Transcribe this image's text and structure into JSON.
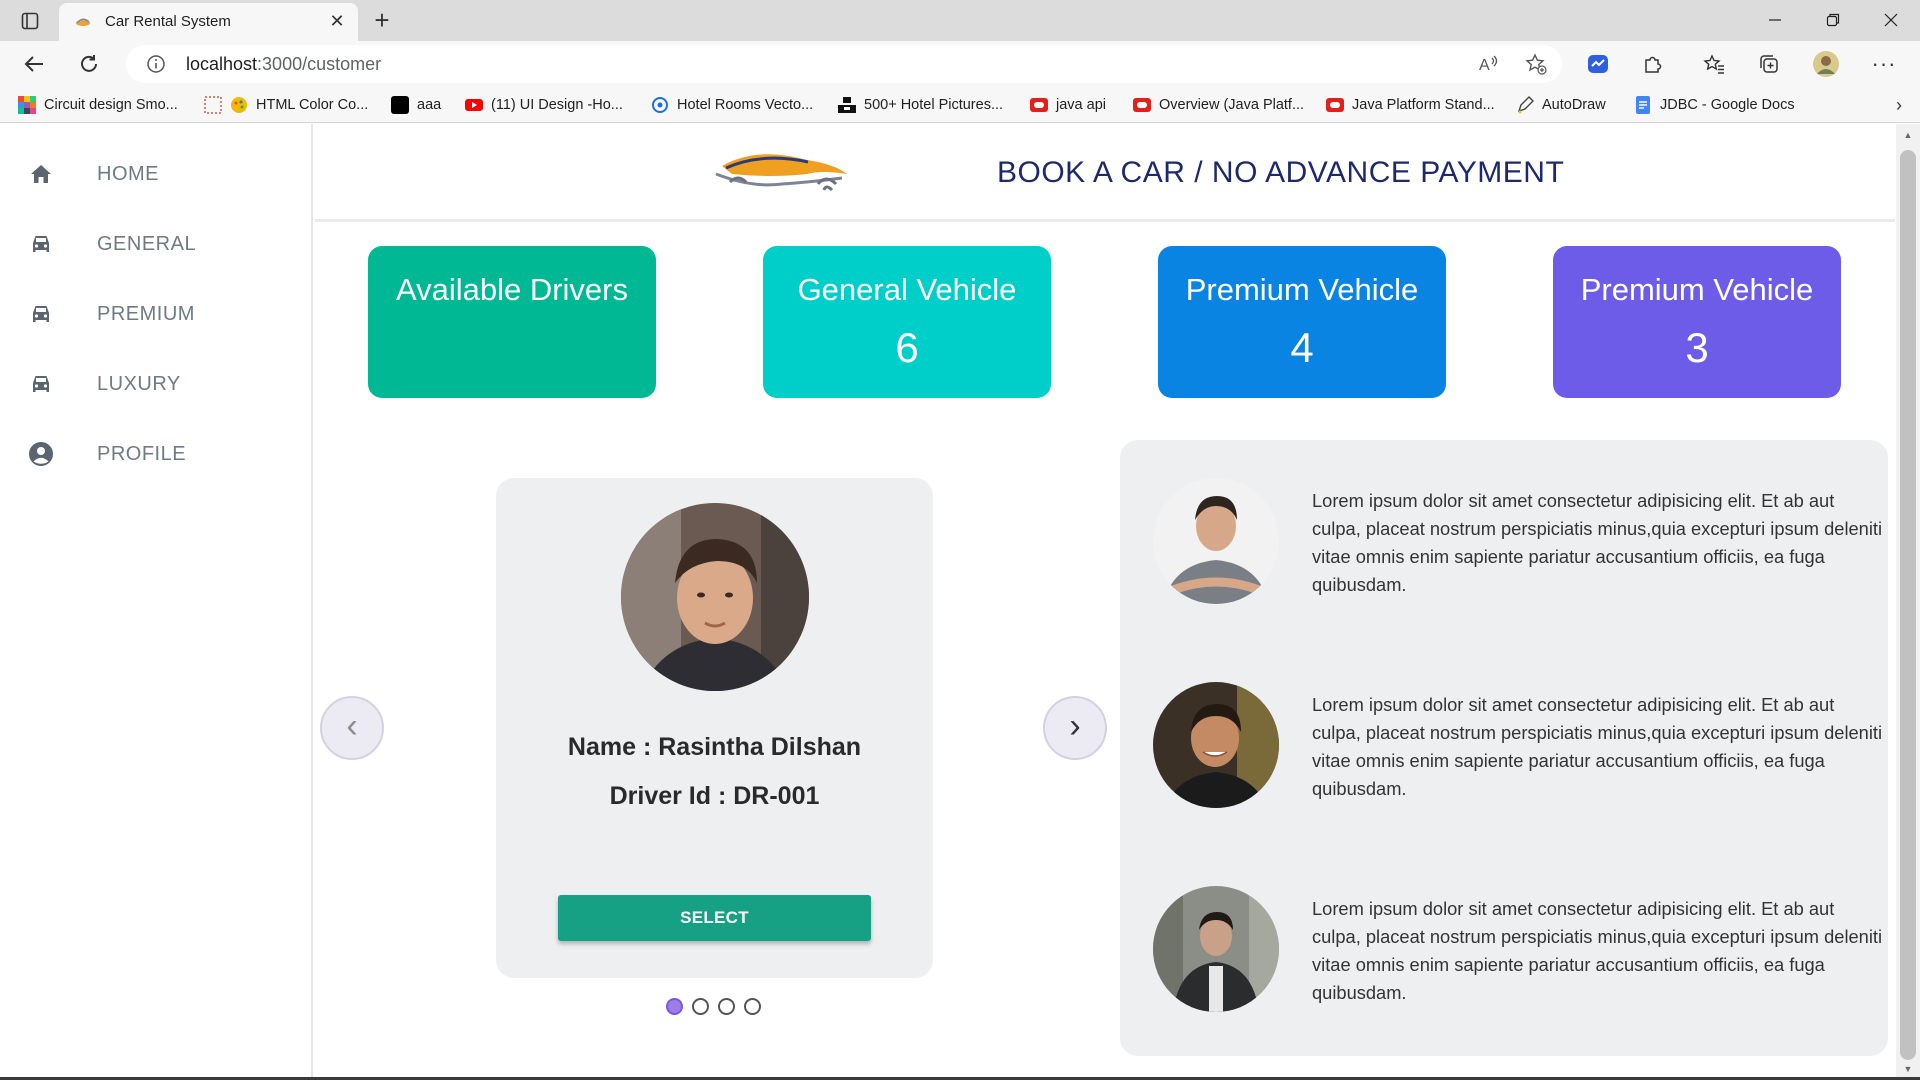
{
  "browser": {
    "tab_title": "Car Rental System",
    "url_host": "localhost",
    "url_path": ":3000/customer",
    "bookmarks": [
      {
        "label": "Circuit design Smo...",
        "icon": "colorful-grid-icon"
      },
      {
        "label": "HTML Color Co...",
        "icon": "palette-icon"
      },
      {
        "label": "aaa",
        "icon": "black-square-icon"
      },
      {
        "label": "(11) UI Design -Ho...",
        "icon": "youtube-icon"
      },
      {
        "label": "Hotel Rooms Vecto...",
        "icon": "vector-icon"
      },
      {
        "label": "500+ Hotel Pictures...",
        "icon": "unsplash-icon"
      },
      {
        "label": "java api",
        "icon": "oracle-icon"
      },
      {
        "label": "Overview (Java Platf...",
        "icon": "oracle-icon"
      },
      {
        "label": "Java Platform Stand...",
        "icon": "oracle-icon"
      },
      {
        "label": "AutoDraw",
        "icon": "pencil-icon"
      },
      {
        "label": "JDBC - Google Docs",
        "icon": "google-docs-icon"
      }
    ]
  },
  "sidebar": {
    "items": [
      {
        "label": "HOME",
        "icon": "home-icon"
      },
      {
        "label": "GENERAL",
        "icon": "car-icon"
      },
      {
        "label": "PREMIUM",
        "icon": "car-icon"
      },
      {
        "label": "LUXURY",
        "icon": "car-icon"
      },
      {
        "label": "PROFILE",
        "icon": "account-circle-icon"
      }
    ]
  },
  "header": {
    "title": "BOOK A CAR / NO ADVANCE PAYMENT"
  },
  "stats": [
    {
      "title": "Available Drivers",
      "value": "",
      "color": "#00b894"
    },
    {
      "title": "General Vehicle",
      "value": "6",
      "color": "#00cec9"
    },
    {
      "title": "Premium Vehicle",
      "value": "4",
      "color": "#0984e3"
    },
    {
      "title": "Premium Vehicle",
      "value": "3",
      "color": "#6c5ce7"
    }
  ],
  "driver": {
    "name": "Name : Rasintha Dilshan",
    "id": "Driver Id : DR-001",
    "select_label": "SELECT",
    "prev_label": "‹",
    "next_label": "›",
    "slides": 4,
    "active_slide": 1
  },
  "testimonials": [
    {
      "text": "Lorem ipsum dolor sit amet consectetur adipisicing elit. Et ab aut culpa, placeat nostrum perspiciatis minus,quia excepturi ipsum deleniti vitae omnis enim sapiente pariatur accusantium officiis, ea fuga quibusdam."
    },
    {
      "text": "Lorem ipsum dolor sit amet consectetur adipisicing elit. Et ab aut culpa, placeat nostrum perspiciatis minus,quia excepturi ipsum deleniti vitae omnis enim sapiente pariatur accusantium officiis, ea fuga quibusdam."
    },
    {
      "text": "Lorem ipsum dolor sit amet consectetur adipisicing elit. Et ab aut culpa, placeat nostrum perspiciatis minus,quia excepturi ipsum deleniti vitae omnis enim sapiente pariatur accusantium officiis, ea fuga quibusdam."
    }
  ]
}
